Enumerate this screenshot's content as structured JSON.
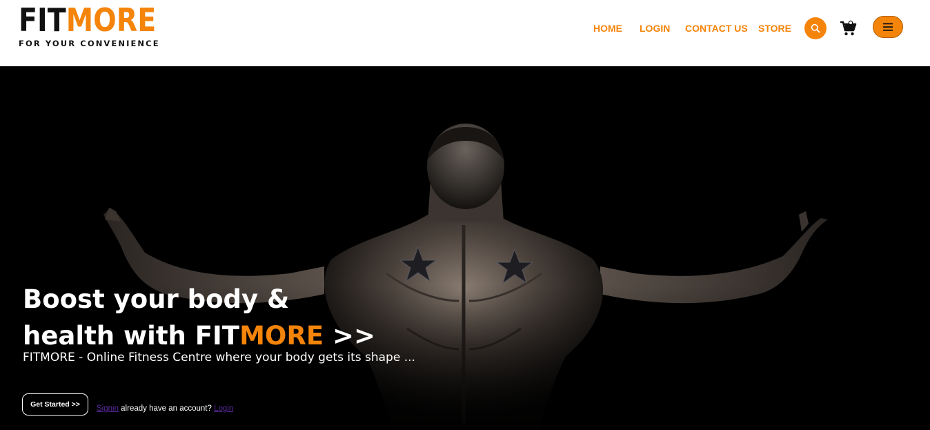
{
  "header": {
    "logo": {
      "fit": "FIT",
      "more": "MORE",
      "tagline": "FOR YOUR CONVENIENCE"
    },
    "nav": [
      {
        "label": "HOME"
      },
      {
        "label": "LOGIN"
      },
      {
        "label": "CONTACT US"
      },
      {
        "label": "STORE"
      }
    ],
    "icons": {
      "search": "search-icon",
      "cart": "cart-icon",
      "menu": "hamburger-menu-icon"
    },
    "accent_color": "#f5840a"
  },
  "hero": {
    "headline_line1": "Boost your body &",
    "headline_line2_prefix": "health with FIT",
    "headline_line2_accent": "MORE",
    "headline_line2_suffix": " >>",
    "subtitle": "FITMORE - Online Fitness Centre where your body gets its shape ...",
    "cta_label": "Get Started >>",
    "signin_link": "Signin",
    "signin_text": " already have an account? ",
    "login_link": "Login"
  }
}
